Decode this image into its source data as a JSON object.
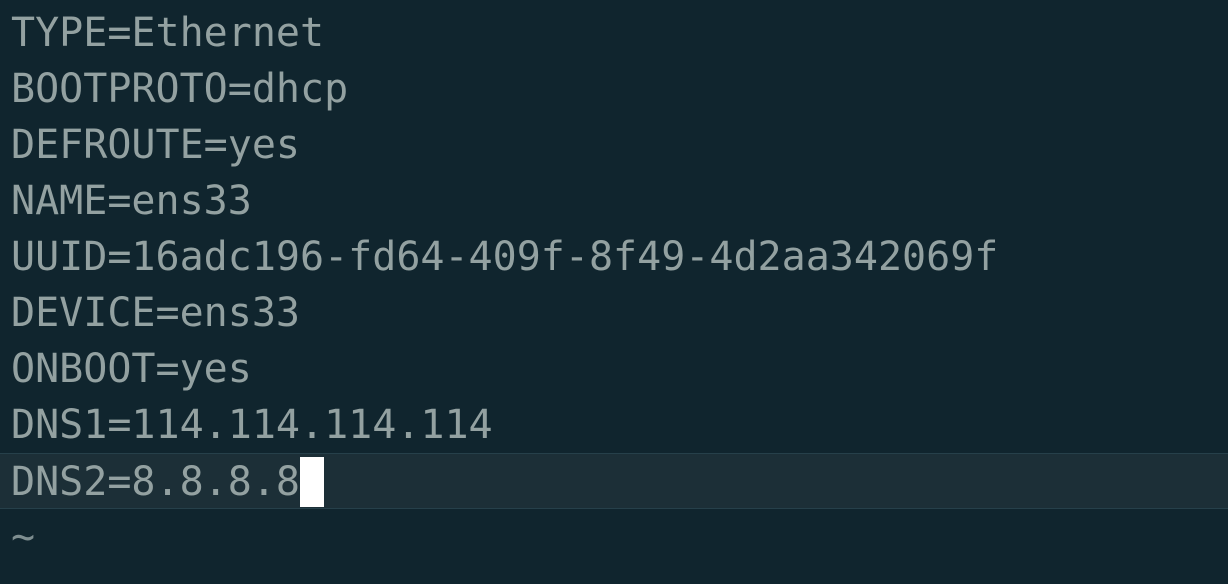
{
  "editor": {
    "lines": [
      "TYPE=Ethernet",
      "BOOTPROTO=dhcp",
      "DEFROUTE=yes",
      "NAME=ens33",
      "UUID=16adc196-fd64-409f-8f49-4d2aa342069f",
      "DEVICE=ens33",
      "ONBOOT=yes",
      "DNS1=114.114.114.114",
      "DNS2=8.8.8.8"
    ],
    "empty_line_marker": "~"
  },
  "colors": {
    "background": "#10252e",
    "current_line": "#1c2f37",
    "text": "#93a1a1",
    "cursor": "#ffffff"
  }
}
